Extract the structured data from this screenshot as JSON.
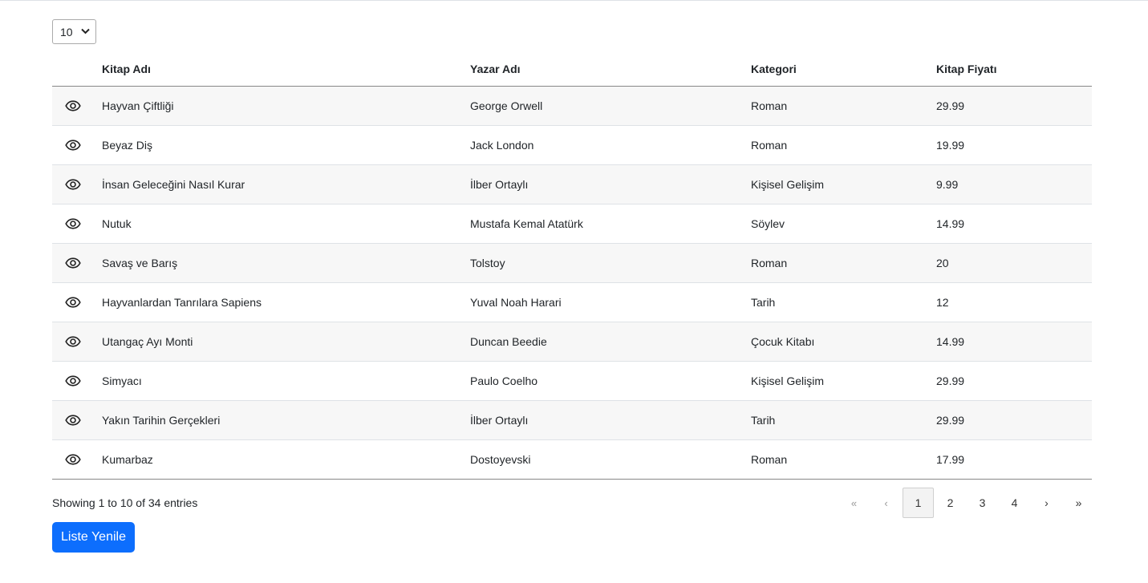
{
  "page_size": {
    "value": "10"
  },
  "table": {
    "headers": [
      "Kitap Adı",
      "Yazar Adı",
      "Kategori",
      "Kitap Fiyatı"
    ],
    "rows": [
      {
        "name": "Hayvan Çiftliği",
        "author": "George Orwell",
        "category": "Roman",
        "price": "29.99"
      },
      {
        "name": "Beyaz Diş",
        "author": "Jack London",
        "category": "Roman",
        "price": "19.99"
      },
      {
        "name": "İnsan Geleceğini Nasıl Kurar",
        "author": "İlber Ortaylı",
        "category": "Kişisel Gelişim",
        "price": "9.99"
      },
      {
        "name": "Nutuk",
        "author": "Mustafa Kemal Atatürk",
        "category": "Söylev",
        "price": "14.99"
      },
      {
        "name": "Savaş ve Barış",
        "author": "Tolstoy",
        "category": "Roman",
        "price": "20"
      },
      {
        "name": "Hayvanlardan Tanrılara Sapiens",
        "author": "Yuval Noah Harari",
        "category": "Tarih",
        "price": "12"
      },
      {
        "name": "Utangaç Ayı Monti",
        "author": "Duncan Beedie",
        "category": "Çocuk Kitabı",
        "price": "14.99"
      },
      {
        "name": "Simyacı",
        "author": "Paulo Coelho",
        "category": "Kişisel Gelişim",
        "price": "29.99"
      },
      {
        "name": "Yakın Tarihin Gerçekleri",
        "author": "İlber Ortaylı",
        "category": "Tarih",
        "price": "29.99"
      },
      {
        "name": "Kumarbaz",
        "author": "Dostoyevski",
        "category": "Roman",
        "price": "17.99"
      }
    ],
    "row_icon": "eye-icon"
  },
  "info": {
    "text": "Showing 1 to 10 of 34 entries"
  },
  "pagination": {
    "first": "«",
    "prev": "‹",
    "pages": [
      "1",
      "2",
      "3",
      "4"
    ],
    "active_page": "1",
    "next": "›",
    "last": "»"
  },
  "actions": {
    "refresh_label": "Liste Yenile"
  },
  "colors": {
    "primary": "#0d6efd",
    "striped_row": "#f7f7f7"
  }
}
